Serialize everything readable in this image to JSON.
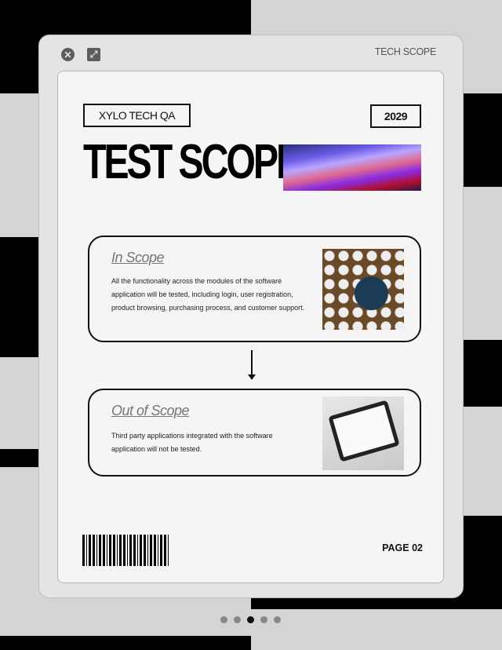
{
  "window": {
    "title": "TECH SCOPE",
    "close_icon": "close-icon",
    "expand_icon": "expand-icon"
  },
  "document": {
    "brand": "XYLO TECH QA",
    "year": "2029",
    "title": "TEST SCOPE",
    "in_scope": {
      "heading": "In Scope",
      "body": "All the functionality across the modules of the software application will be tested, including login, user registration, product browsing, purchasing process, and customer support."
    },
    "out_of_scope": {
      "heading": "Out of Scope",
      "body": "Third party applications integrated with the software application will not be tested."
    },
    "page_number": "PAGE 02"
  },
  "pagination": {
    "total": 5,
    "active": 3
  }
}
